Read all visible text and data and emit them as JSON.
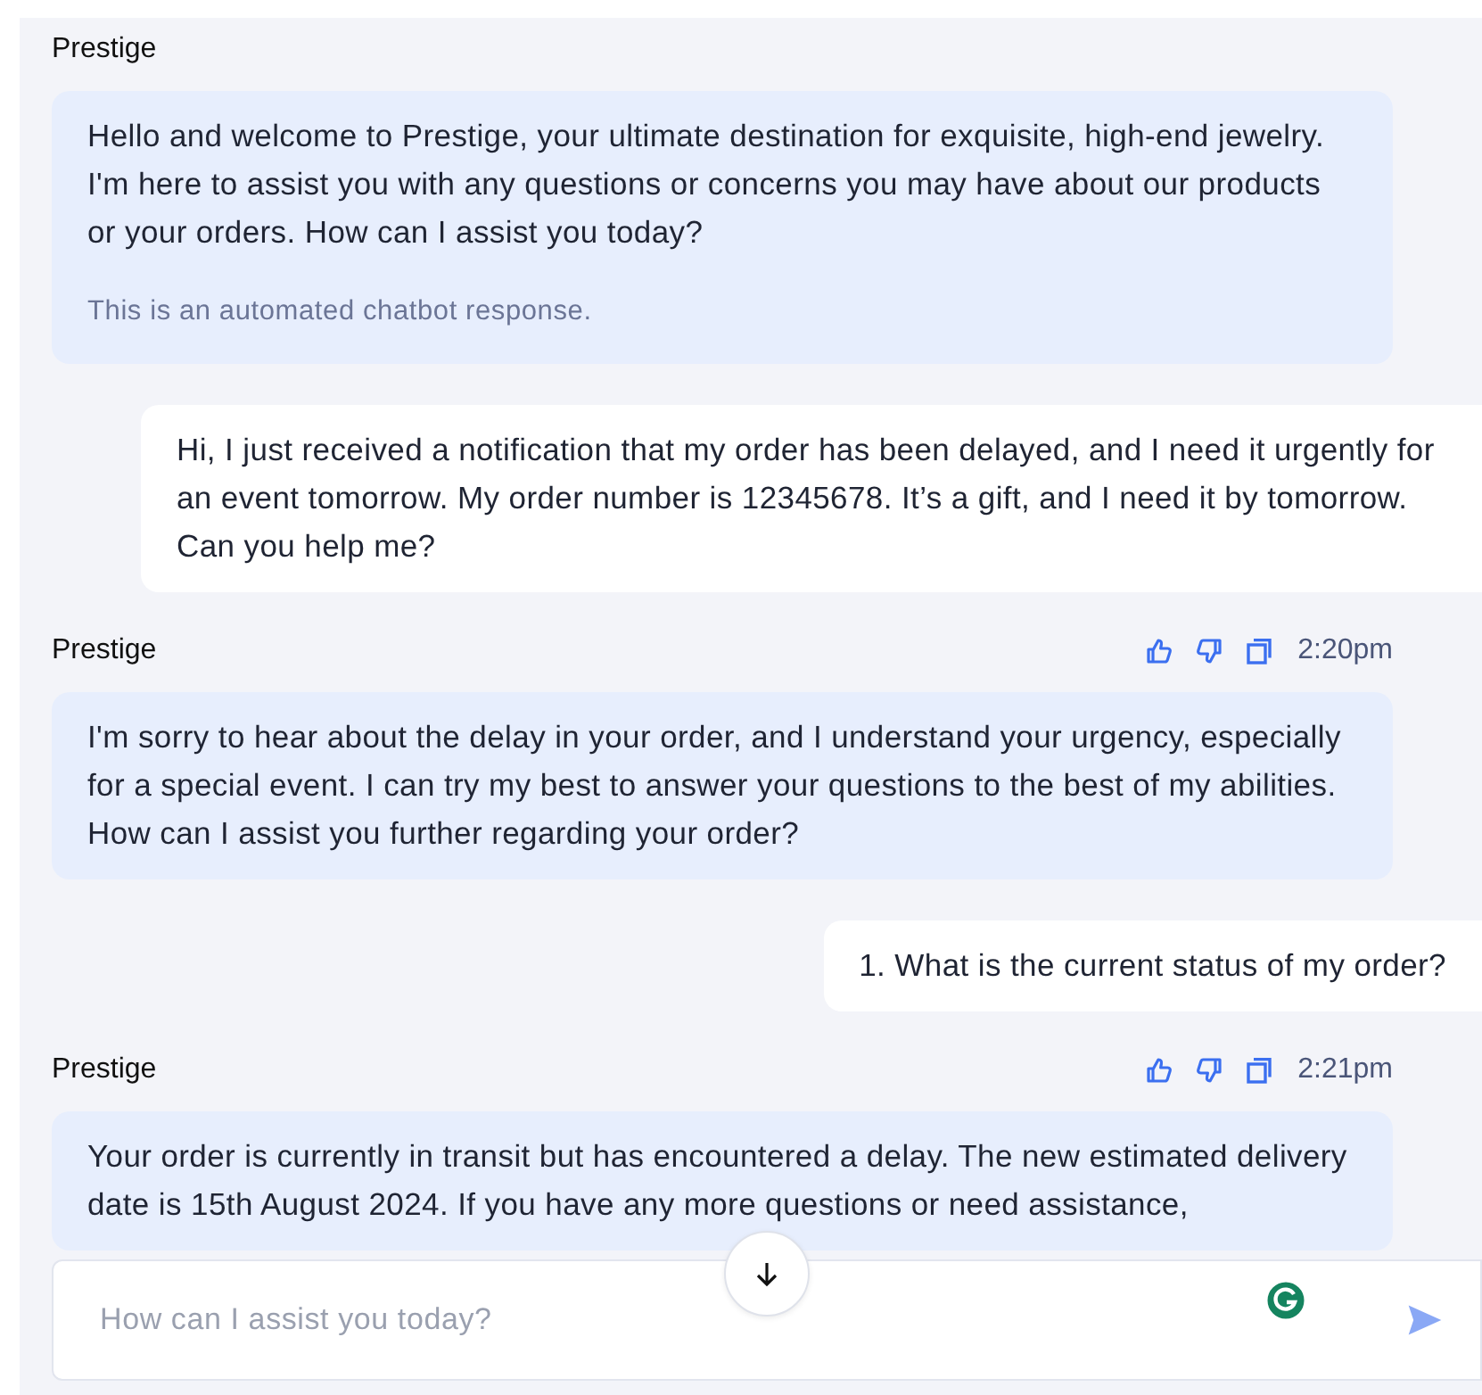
{
  "messages": [
    {
      "kind": "bot",
      "sender": "Prestige",
      "text": "Hello and welcome to Prestige, your ultimate destination for exquisite, high-end jewelry. I'm here to assist you with any questions or concerns you may have about our products or your orders. How can I assist you today?",
      "note": "This is an automated chatbot response."
    },
    {
      "kind": "user",
      "text": "Hi, I just received a notification that my order has been delayed, and I need it urgently for an event tomorrow. My order number is 12345678. It’s a gift, and I need it by tomorrow. Can you help me?"
    },
    {
      "kind": "bot",
      "sender": "Prestige",
      "time": "2:20pm",
      "text": "I'm sorry to hear about the delay in your order, and I understand your urgency, especially for a special event. I can try my best to answer your questions to the best of my abilities. How can I assist you further regarding your order?"
    },
    {
      "kind": "user",
      "text": "1. What is the current status of my order?"
    },
    {
      "kind": "bot",
      "sender": "Prestige",
      "time": "2:21pm",
      "text": "Your order is currently in transit but has encountered a delay. The new estimated delivery date is 15th August 2024. If you have any more questions or need assistance,"
    }
  ],
  "composer": {
    "placeholder": "How can I assist you today?"
  }
}
